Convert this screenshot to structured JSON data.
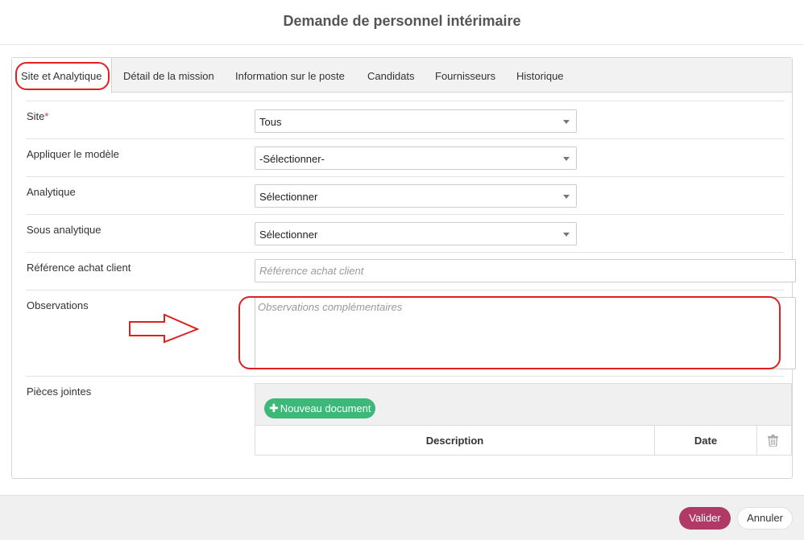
{
  "page_title": "Demande de personnel intérimaire",
  "tabs": [
    {
      "label": "Site et Analytique",
      "active": true
    },
    {
      "label": "Détail de la mission"
    },
    {
      "label": "Information sur le poste"
    },
    {
      "label": "Candidats"
    },
    {
      "label": "Fournisseurs"
    },
    {
      "label": "Historique"
    }
  ],
  "form": {
    "site": {
      "label": "Site",
      "required_mark": "*",
      "value": "Tous"
    },
    "modele": {
      "label": "Appliquer le modèle",
      "value": "-Sélectionner-"
    },
    "analytique": {
      "label": "Analytique",
      "value": "Sélectionner"
    },
    "sous_analytique": {
      "label": "Sous analytique",
      "value": "Sélectionner"
    },
    "reference": {
      "label": "Référence achat client",
      "placeholder": "Référence achat client"
    },
    "observations": {
      "label": "Observations",
      "placeholder": "Observations complémentaires"
    },
    "pieces": {
      "label": "Pièces jointes",
      "new_button": "Nouveau document",
      "columns": [
        "Description",
        "Date"
      ]
    }
  },
  "footer": {
    "valider": "Valider",
    "annuler": "Annuler"
  },
  "colors": {
    "annotation": "#e02020",
    "primary": "#b03a65",
    "success": "#3cb878"
  },
  "icons": {
    "trash": "trash-icon",
    "plus": "plus-icon",
    "annotation_arrow": "arrow-right-icon"
  }
}
